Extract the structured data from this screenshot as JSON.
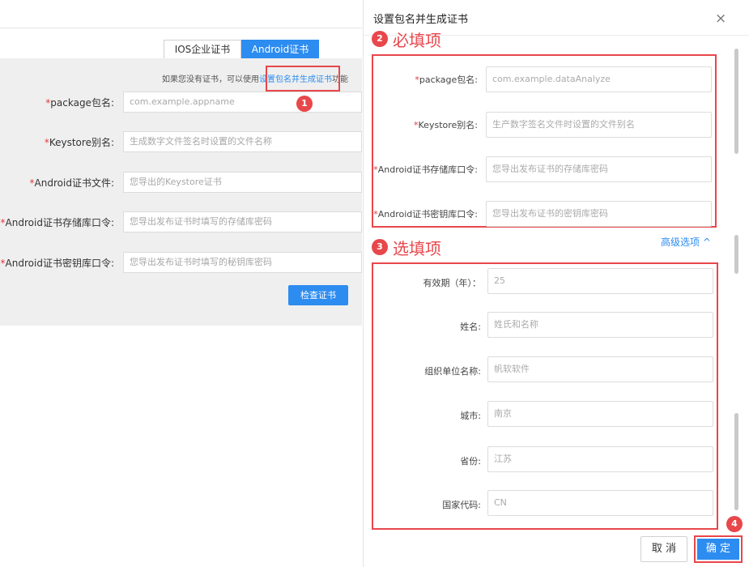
{
  "left": {
    "tabs": [
      {
        "label": "IOS企业证书",
        "active": false
      },
      {
        "label": "Android证书",
        "active": true
      }
    ],
    "hint_prefix": "如果您没有证书，可以使用",
    "hint_link": "设置包名并生成证书",
    "hint_suffix": "功能",
    "fields": [
      {
        "label": "package包名:",
        "placeholder": "com.example.appname"
      },
      {
        "label": "Keystore别名:",
        "placeholder": "生成数字文件签名时设置的文件名称"
      },
      {
        "label": "Android证书文件:",
        "placeholder": "您导出的Keystore证书"
      },
      {
        "label": "Android证书存储库口令:",
        "placeholder": "您导出发布证书时填写的存储库密码"
      },
      {
        "label": "Android证书密钥库口令:",
        "placeholder": "您导出发布证书时填写的秘钥库密码"
      }
    ],
    "check_button": "检查证书"
  },
  "dialog": {
    "title": "设置包名并生成证书",
    "close_glyph": "×",
    "required_fields": [
      {
        "label": "package包名:",
        "placeholder": "com.example.dataAnalyze"
      },
      {
        "label": "Keystore别名:",
        "placeholder": "生产数字签名文件时设置的文件别名"
      },
      {
        "label": "Android证书存储库口令:",
        "placeholder": "您导出发布证书的存储库密码"
      },
      {
        "label": "Android证书密钥库口令:",
        "placeholder": "您导出发布证书的密钥库密码"
      }
    ],
    "advanced_label": "高级选项",
    "advanced_chevron": "^",
    "optional_fields": [
      {
        "label": "有效期（年）：",
        "placeholder": "25"
      },
      {
        "label": "姓名:",
        "placeholder": "姓氏和名称"
      },
      {
        "label": "组织单位名称:",
        "placeholder": "帆软软件"
      },
      {
        "label": "城市:",
        "placeholder": "南京"
      },
      {
        "label": "省份:",
        "placeholder": "江苏"
      },
      {
        "label": "国家代码:",
        "placeholder": "CN"
      }
    ],
    "cancel_button": "取 消",
    "ok_button": "确 定"
  },
  "annotations": {
    "marker_1": "1",
    "marker_2": "2",
    "marker_3": "3",
    "marker_4": "4",
    "required_heading": "必填项",
    "optional_heading": "选填项"
  },
  "colors": {
    "primary": "#2d8cf0",
    "annotation_red": "#e8474b",
    "required_star": "#e4393c"
  }
}
